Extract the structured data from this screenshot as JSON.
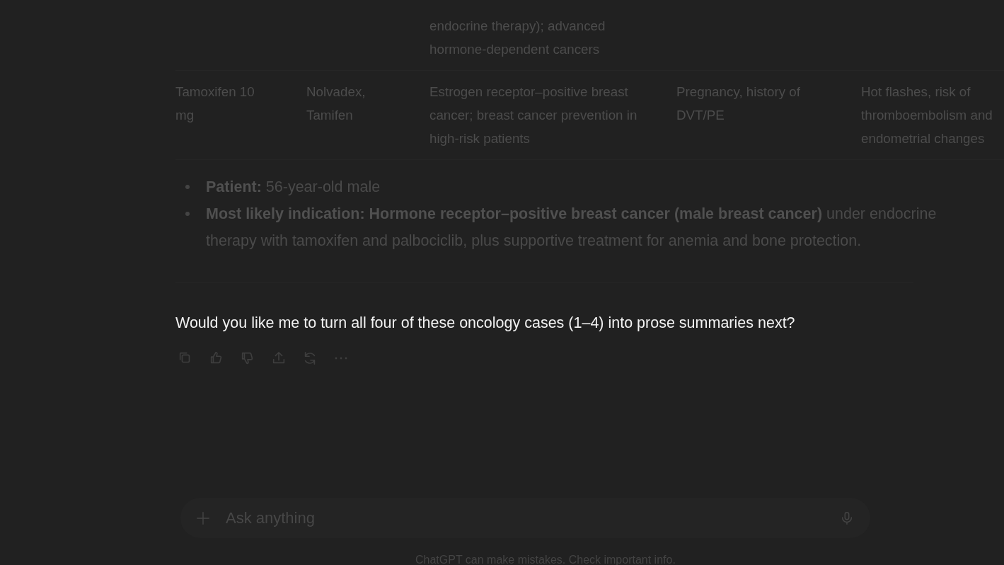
{
  "table": {
    "rows": [
      {
        "column_3": "endocrine therapy); advanced hormone-dependent cancers"
      },
      {
        "column_1": "Tamoxifen 10 mg",
        "column_2": "Nolvadex, Tamifen",
        "column_3": "Estrogen receptor–positive breast cancer; breast cancer prevention in high-risk patients",
        "column_4": "Pregnancy, history of DVT/PE",
        "column_5": "Hot flashes, risk of thromboembolism and endometrial changes"
      }
    ]
  },
  "summary": {
    "items": [
      "**Patient:** 56-year-old male",
      "**Most likely indication: Hormone receptor–positive breast cancer (male breast cancer)** under endocrine therapy with tamoxifen and palbociclib, plus supportive treatment for anemia and bone protection."
    ]
  },
  "question": {
    "text": "Would you like me to turn all four of these oncology cases (1–4) into prose summaries next?",
    "highlighted": true
  },
  "composer": {
    "placeholder": "Ask anything"
  },
  "footer": "ChatGPT can make mistakes. Check important info."
}
